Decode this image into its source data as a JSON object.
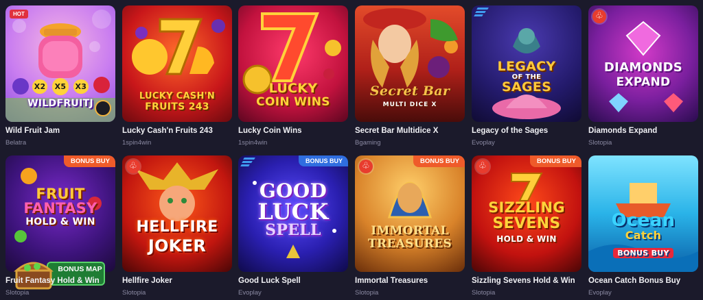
{
  "games": [
    {
      "title": "Wild Fruit Jam",
      "provider": "Belatra",
      "badge": "HOT",
      "logo": "WILDFRUITJ",
      "multipliers": [
        "X2",
        "X5",
        "X3"
      ]
    },
    {
      "title": "Lucky Cash'n Fruits 243",
      "provider": "1spin4win",
      "logo_line1": "LUCKY CASH'N",
      "logo_line2": "FRUITS 243"
    },
    {
      "title": "Lucky Coin Wins",
      "provider": "1spin4win",
      "logo_line1": "LUCKY",
      "logo_line2": "COIN WINS"
    },
    {
      "title": "Secret Bar Multidice X",
      "provider": "Bgaming",
      "logo_line1": "Secret Bar",
      "logo_line2": "MULTI DICE X"
    },
    {
      "title": "Legacy of the Sages",
      "provider": "Evoplay",
      "logo_line1": "LEGACY",
      "logo_line2": "OF THE",
      "logo_line3": "SAGES"
    },
    {
      "title": "Diamonds Expand",
      "provider": "Slotopia",
      "logo_line1": "DIAMONDS",
      "logo_line2": "EXPAND"
    },
    {
      "title": "Fruit Fantasy Hold & Win",
      "provider": "Slotopia",
      "badge": "BONUS BUY",
      "logo_line1": "FRUIT",
      "logo_line2": "FANTASY",
      "logo_line3": "HOLD & WIN",
      "bonus_map": "BONUS MAP"
    },
    {
      "title": "Hellfire Joker",
      "provider": "Slotopia",
      "logo_line1": "HELLFIRE",
      "logo_line2": "JOKER"
    },
    {
      "title": "Good Luck Spell",
      "provider": "Evoplay",
      "badge": "BONUS BUY",
      "logo_line1": "GOOD",
      "logo_line2": "LUCK",
      "logo_line3": "SPELL"
    },
    {
      "title": "Immortal Treasures",
      "provider": "Slotopia",
      "badge": "BONUS BUY",
      "logo_line1": "IMMORTAL",
      "logo_line2": "TREASURES"
    },
    {
      "title": "Sizzling Sevens Hold & Win",
      "provider": "Slotopia",
      "badge": "BONUS BUY",
      "logo_line1": "SIZZLING",
      "logo_line2": "SEVENS",
      "logo_line3": "HOLD & WIN"
    },
    {
      "title": "Ocean Catch Bonus Buy",
      "provider": "Evoplay",
      "logo_line1": "Ocean",
      "logo_line2": "Catch",
      "logo_line3": "BONUS BUY"
    }
  ],
  "icons": {
    "hot": "hot-fire-icon",
    "provider_stripes": "provider-stripes-icon",
    "treasure": "treasure-chest-icon"
  }
}
